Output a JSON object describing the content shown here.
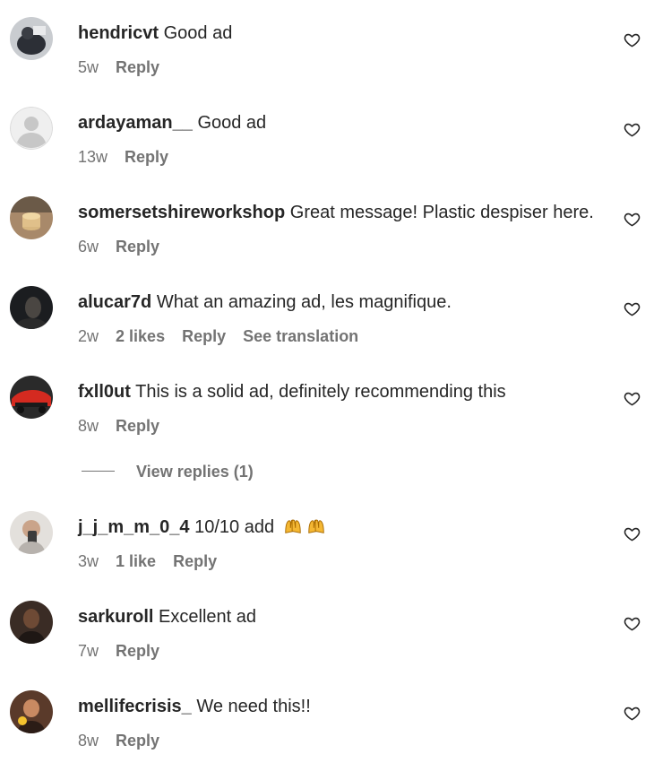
{
  "comments": [
    {
      "user": "hendricvt",
      "text": "Good ad",
      "time": "5w",
      "reply": "Reply"
    },
    {
      "user": "ardayaman__",
      "text": "Good ad",
      "time": "13w",
      "reply": "Reply"
    },
    {
      "user": "somersetshireworkshop",
      "text": "Great message! Plastic despiser here.",
      "time": "6w",
      "reply": "Reply"
    },
    {
      "user": "alucar7d",
      "text": "What an amazing ad, les magnifique.",
      "time": "2w",
      "likes": "2 likes",
      "reply": "Reply",
      "translate": "See translation"
    },
    {
      "user": "fxll0ut",
      "text": "This is a solid ad, definitely recommending this",
      "time": "8w",
      "reply": "Reply"
    },
    {
      "user": "j_j_m_m_0_4",
      "text": "10/10 add",
      "time": "3w",
      "likes": "1 like",
      "reply": "Reply"
    },
    {
      "user": "sarkuroll",
      "text": "Excellent ad",
      "time": "7w",
      "reply": "Reply"
    },
    {
      "user": "mellifecrisis_",
      "text": "We need this!!",
      "time": "8w",
      "reply": "Reply"
    }
  ],
  "view_replies": "View replies (1)",
  "icons": {
    "like": "heart-icon",
    "emoji": "raising-hands-emoji"
  }
}
